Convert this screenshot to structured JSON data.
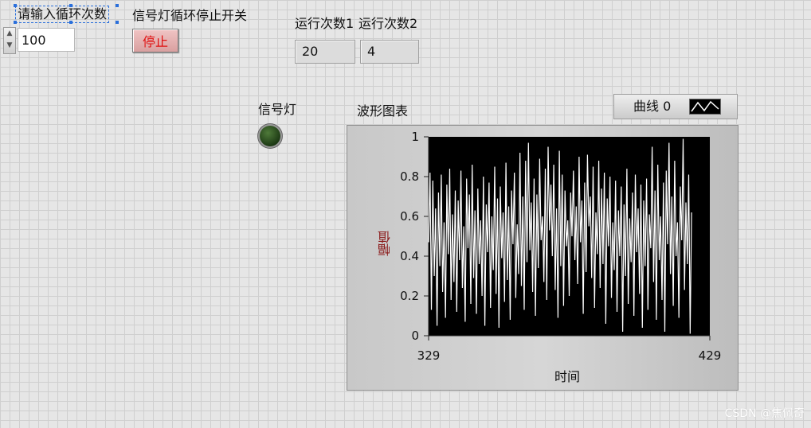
{
  "loop_control": {
    "label": "请输入循环次数",
    "value": "100"
  },
  "stop_switch": {
    "label": "信号灯循环停止开关",
    "button_label": "停止"
  },
  "indicators": [
    {
      "label": "运行次数1",
      "value": "20"
    },
    {
      "label": "运行次数2",
      "value": "4"
    }
  ],
  "signal_light": {
    "label": "信号灯",
    "state": "off",
    "color": "#2c4a20"
  },
  "legend": {
    "label": "曲线 0",
    "icon": "line-plot-icon"
  },
  "watermark": "CSDN @焦佩奇",
  "chart_data": {
    "type": "line",
    "title": "波形图表",
    "xlabel": "时间",
    "ylabel": "幅值",
    "xlim": [
      329,
      429
    ],
    "ylim": [
      0,
      1
    ],
    "x_ticks": [
      "329",
      "429"
    ],
    "y_ticks": [
      "0",
      "0.2",
      "0.4",
      "0.6",
      "0.8",
      "1"
    ],
    "series": [
      {
        "color": "#ffffff",
        "x_start": 329,
        "x_step": 0.5,
        "values": [
          0.47,
          0.82,
          0.13,
          0.78,
          0.3,
          0.64,
          0.05,
          0.72,
          0.35,
          0.81,
          0.22,
          0.57,
          0.09,
          0.76,
          0.41,
          0.84,
          0.18,
          0.61,
          0.27,
          0.73,
          0.12,
          0.68,
          0.38,
          0.83,
          0.24,
          0.55,
          0.07,
          0.79,
          0.44,
          0.71,
          0.16,
          0.86,
          0.29,
          0.63,
          0.11,
          0.74,
          0.36,
          0.58,
          0.2,
          0.8,
          0.05,
          0.66,
          0.42,
          0.77,
          0.14,
          0.6,
          0.33,
          0.85,
          0.21,
          0.69,
          0.04,
          0.75,
          0.39,
          0.62,
          0.17,
          0.87,
          0.28,
          0.65,
          0.08,
          0.73,
          0.46,
          0.82,
          0.19,
          0.56,
          0.31,
          0.92,
          0.25,
          0.7,
          0.13,
          0.88,
          0.37,
          0.97,
          0.43,
          0.67,
          0.22,
          0.79,
          0.1,
          0.71,
          0.34,
          0.89,
          0.48,
          0.6,
          0.27,
          0.84,
          0.18,
          0.95,
          0.53,
          0.76,
          0.4,
          0.86,
          0.23,
          0.64,
          0.09,
          0.93,
          0.35,
          0.81,
          0.15,
          0.73,
          0.45,
          0.58,
          0.2,
          0.72,
          0.5,
          0.83,
          0.38,
          0.65,
          0.26,
          0.9,
          0.47,
          0.68,
          0.11,
          0.77,
          0.32,
          0.91,
          0.55,
          0.7,
          0.29,
          0.85,
          0.14,
          0.62,
          0.41,
          0.88,
          0.24,
          0.74,
          0.36,
          0.82,
          0.06,
          0.69,
          0.45,
          0.8,
          0.19,
          0.57,
          0.33,
          0.78,
          0.12,
          0.63,
          0.4,
          0.75,
          0.02,
          0.66,
          0.3,
          0.84,
          0.16,
          0.59,
          0.37,
          0.72,
          0.1,
          0.81,
          0.42,
          0.64,
          0.21,
          0.76,
          0.04,
          0.68,
          0.35,
          0.79,
          0.13,
          0.61,
          0.44,
          0.95,
          0.27,
          0.73,
          0.08,
          0.86,
          0.38,
          0.6,
          0.18,
          0.77,
          0.02,
          0.83,
          0.46,
          0.97,
          0.31,
          0.7,
          0.15,
          0.88,
          0.4,
          0.57,
          0.09,
          0.75,
          0.48,
          0.99,
          0.23,
          0.67,
          0.36,
          0.81,
          0.01,
          0.62
        ]
      }
    ]
  }
}
